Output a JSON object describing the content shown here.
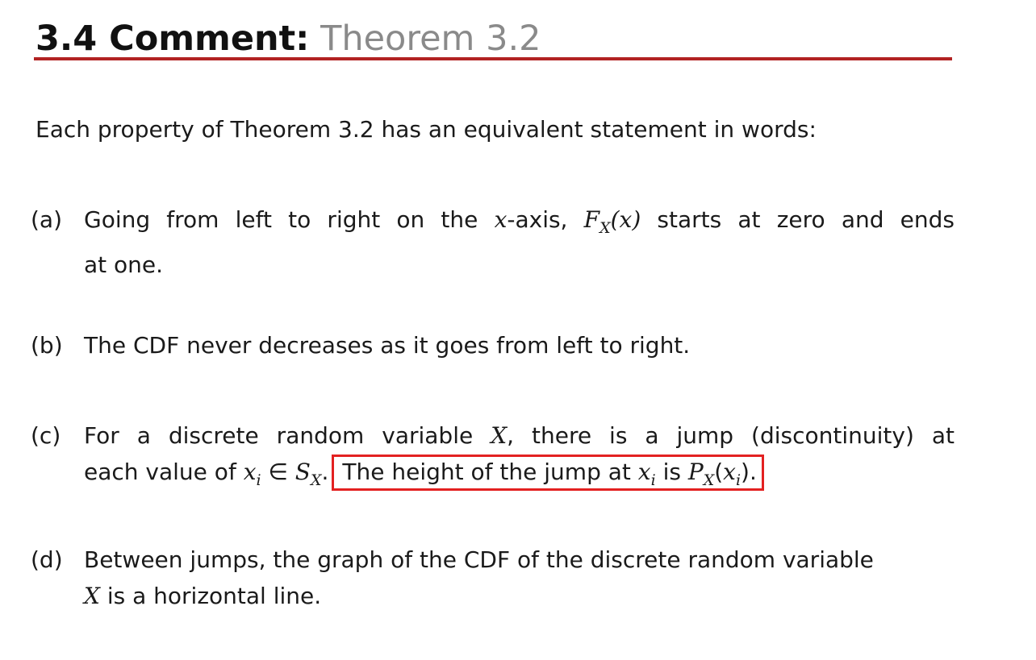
{
  "title": {
    "main": "3.4 Comment:",
    "sub": "Theorem 3.2"
  },
  "intro": "Each property of Theorem 3.2 has an equivalent statement in words:",
  "items": {
    "a": {
      "label": "(a)",
      "line1_text1": "Going from left to right on the ",
      "line1_math1": "x",
      "line1_text2": "-axis, ",
      "line1_math2": "F",
      "line1_math2_sub": "X",
      "line1_math3": "(x)",
      "line1_text3": " starts at zero and ends",
      "line2": "at one."
    },
    "b": {
      "label": "(b)",
      "text": "The CDF never decreases as it goes from left to right."
    },
    "c": {
      "label": "(c)",
      "line1_text1": "For a discrete random variable ",
      "line1_math1": "X",
      "line1_text2": ", there is a jump (discontinuity) at",
      "line2_text1": "each value of ",
      "line2_math1": "x",
      "line2_math1_sub": "i",
      "line2_text2": " ∈ ",
      "line2_math2": "S",
      "line2_math2_sub": "X",
      "line2_text3": ".",
      "highlight_text1": "The height of the jump at ",
      "highlight_math1": "x",
      "highlight_math1_sub": "i",
      "highlight_text2": " is ",
      "highlight_math2": "P",
      "highlight_math2_sub": "X",
      "highlight_text3": "(",
      "highlight_math3": "x",
      "highlight_math3_sub": "i",
      "highlight_text4": ")."
    },
    "d": {
      "label": "(d)",
      "line1": "Between jumps, the graph of the CDF of the discrete random variable",
      "line2_math1": "X",
      "line2_text1": " is a horizontal line."
    }
  },
  "colors": {
    "rule": "#b22222",
    "highlight_border": "#e32121",
    "title_sub": "#8a8a8a"
  }
}
